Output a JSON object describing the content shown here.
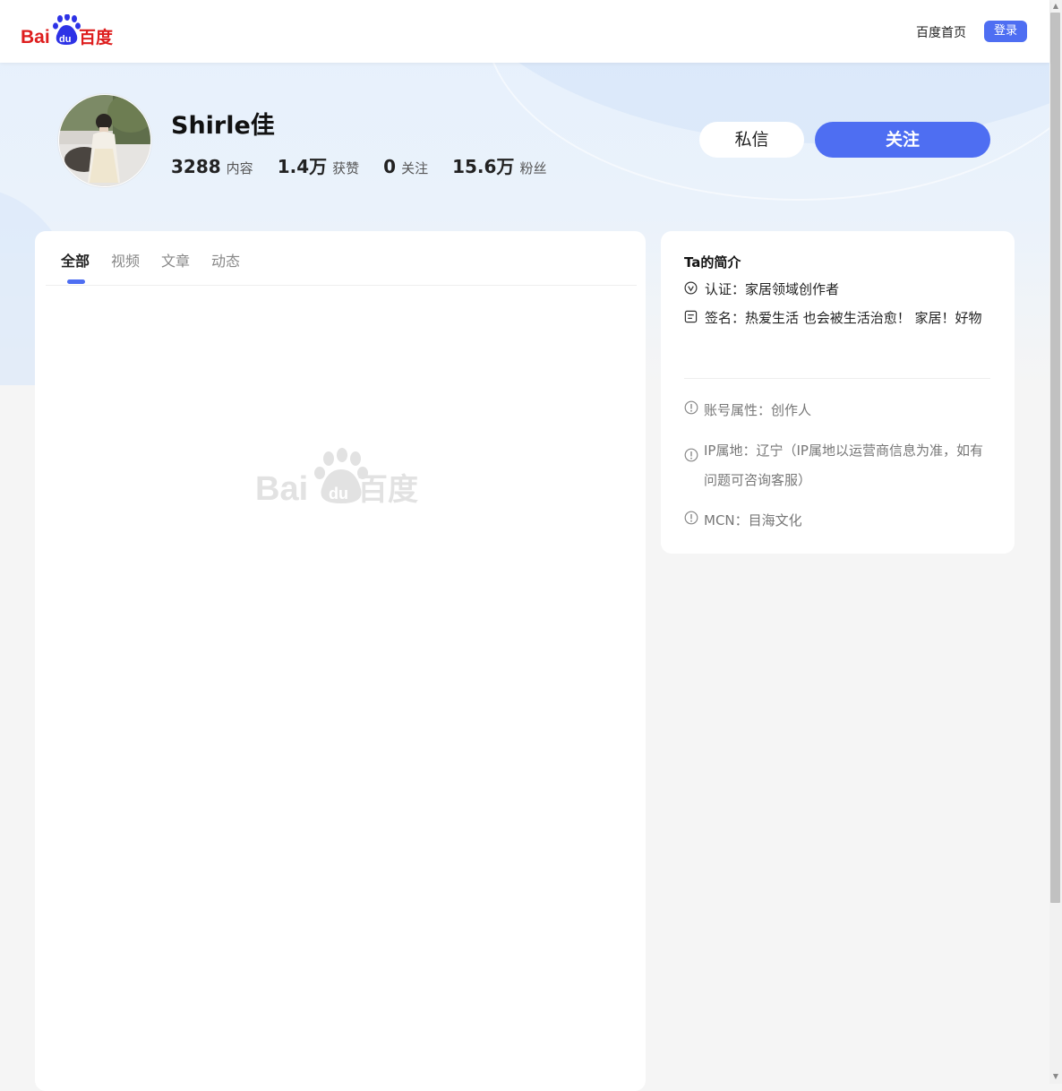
{
  "header": {
    "logo_text": "Bai du 百度",
    "home_link": "百度首页",
    "login_button": "登录"
  },
  "profile": {
    "name": "Shirle佳",
    "stats": [
      {
        "value": "3288",
        "label": "内容"
      },
      {
        "value": "1.4万",
        "label": "获赞"
      },
      {
        "value": "0",
        "label": "关注"
      },
      {
        "value": "15.6万",
        "label": "粉丝"
      }
    ],
    "message_button": "私信",
    "follow_button": "关注"
  },
  "tabs": [
    {
      "label": "全部",
      "active": true
    },
    {
      "label": "视频",
      "active": false
    },
    {
      "label": "文章",
      "active": false
    },
    {
      "label": "动态",
      "active": false
    }
  ],
  "intro": {
    "title": "Ta的简介",
    "certification": "认证：家居领域创作者",
    "signature": "签名：热爱生活 也会被生活治愈！ 家居！好物",
    "account_type": "账号属性：创作人",
    "ip_location": "IP属地：辽宁（IP属地以运营商信息为准，如有问题可咨询客服）",
    "mcn": "MCN：目海文化"
  },
  "colors": {
    "brand_blue": "#4e6ef2",
    "baidu_red": "#de1e1e",
    "baidu_blue": "#2d32e6"
  }
}
